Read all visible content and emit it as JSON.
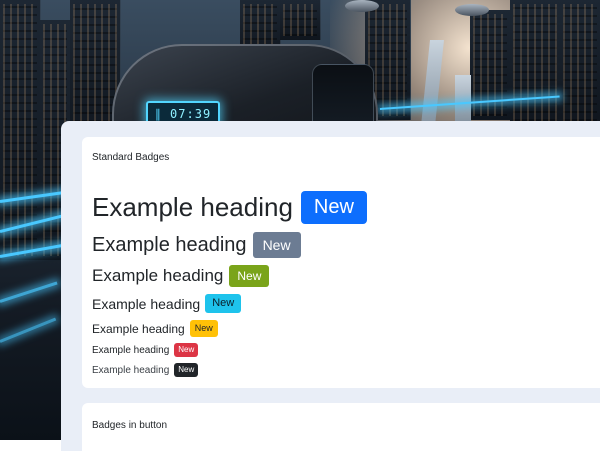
{
  "background": {
    "clock_display": "07:39",
    "description_icon": "futuristic-city-train-wallpaper"
  },
  "cards": {
    "standard": {
      "title": "Standard Badges",
      "rows": [
        {
          "heading": "Example heading",
          "badge": "New",
          "badge_color": "#0d6efd"
        },
        {
          "heading": "Example heading",
          "badge": "New",
          "badge_color": "#6c7c93"
        },
        {
          "heading": "Example heading",
          "badge": "New",
          "badge_color": "#7aa41a"
        },
        {
          "heading": "Example heading",
          "badge": "New",
          "badge_color": "#1ec3ec"
        },
        {
          "heading": "Example heading",
          "badge": "New",
          "badge_color": "#ffc107"
        },
        {
          "heading": "Example heading",
          "badge": "New",
          "badge_color": "#dc3545"
        },
        {
          "heading": "Example heading",
          "badge": "New",
          "badge_color": "#212529"
        }
      ]
    },
    "buttons": {
      "title": "Badges in button"
    }
  }
}
